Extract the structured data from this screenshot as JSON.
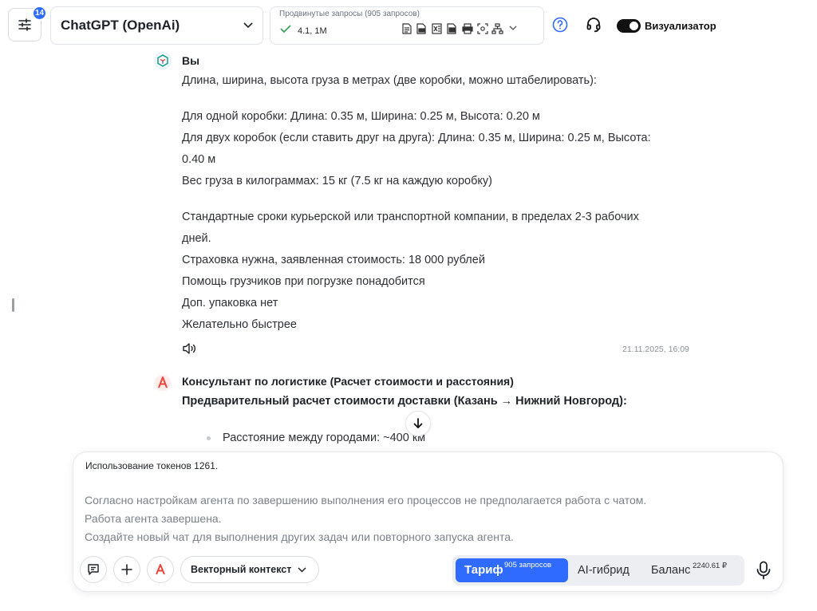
{
  "header": {
    "settings_badge": "14",
    "model": "ChatGPT (OpenAi)",
    "advanced": {
      "title": "Продвинутые запросы (905 запросов)",
      "version": "4.1, 1M"
    },
    "toggle_label": "Визуализатор",
    "toggle_on": true
  },
  "messages": [
    {
      "author": "Вы",
      "lines": [
        "Длина, ширина, высота груза в метрах (две коробки, можно штабелировать):",
        "Для одной коробки: Длина: 0.35 м, Ширина: 0.25 м, Высота: 0.20 м",
        "Для двух коробок (если ставить друг на друга): Длина: 0.35 м, Ширина: 0.25 м, Высота:",
        "0.40 м",
        "Вес груза в килограммах: 15 кг (7.5 кг на каждую коробку)",
        "Стандартные сроки курьерской или транспортной компании, в пределах 2-3 рабочих",
        "дней.",
        "Страховка нужна, заявленная стоимость: 18 000 рублей",
        "Помощь грузчиков при погрузке понадобится",
        "Доп. упаковка нет",
        "Желательно быстрее"
      ],
      "timestamp": "21.11.2025, 16:09"
    },
    {
      "author": "Консультант по логистике (Расчет стоимости и расстояния)",
      "subheading": "Предварительный расчет стоимости доставки (Казань → Нижний Новгород):",
      "bullets": [
        "Расстояние между городами: ~400 км"
      ]
    }
  ],
  "composer": {
    "token_usage": "Использование токенов 1261.",
    "notice": [
      "Согласно настройкам агента по завершению выполнения его процессов не предполагается работа с чатом.",
      "Работа агента завершена.",
      "Создайте новый чат для выполнения других задач или повторного запуска агента."
    ],
    "vector_context": "Векторный контекст",
    "modes": {
      "tariff": "Тариф",
      "tariff_sup": "905 запросов",
      "hybrid": "AI-гибрид",
      "balance": "Баланс",
      "balance_sup": "2240.61 ₽"
    }
  },
  "colors": {
    "accent": "#2f6bff",
    "agent_icon": "#e8453c"
  }
}
